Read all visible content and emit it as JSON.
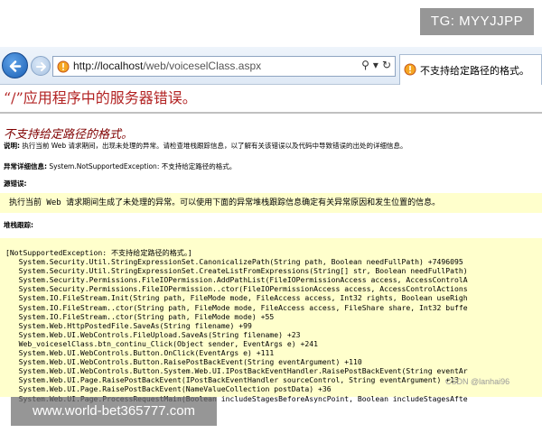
{
  "watermark_top": "TG: MYYJJPP",
  "watermark_bottom": "www.world-bet365777.com",
  "watermark_csdn": "CSDN @lanhai96",
  "browser": {
    "url_host": "http://localhost",
    "url_path": "/web/voiceselClass.aspx",
    "search_icon": "search-icon",
    "refresh_icon": "refresh-icon",
    "tab_title": "不支持给定路径的格式。"
  },
  "page": {
    "app_title": "“/”应用程序中的服务器错误。",
    "error_title": "不支持给定路径的格式。",
    "description_label": "说明:",
    "description_text": "执行当前 Web 请求期间，出现未处理的异常。请检查堆栈跟踪信息，以了解有关该错误以及代码中导致错误的出处的详细信息。",
    "exception_label": "异常详细信息:",
    "exception_text": "System.NotSupportedException: 不支持给定路径的格式。",
    "source_label": "源错误:",
    "source_hint": "执行当前 Web 请求期间生成了未处理的异常。可以使用下面的异常堆栈跟踪信息确定有关异常原因和发生位置的信息。",
    "stack_label": "堆栈跟踪:",
    "stack_trace": [
      "[NotSupportedException: 不支持给定路径的格式。]",
      "   System.Security.Util.StringExpressionSet.CanonicalizePath(String path, Boolean needFullPath) +7496095",
      "   System.Security.Util.StringExpressionSet.CreateListFromExpressions(String[] str, Boolean needFullPath)",
      "   System.Security.Permissions.FileIOPermission.AddPathList(FileIOPermissionAccess access, AccessControlA",
      "   System.Security.Permissions.FileIOPermission..ctor(FileIOPermissionAccess access, AccessControlActions",
      "   System.IO.FileStream.Init(String path, FileMode mode, FileAccess access, Int32 rights, Boolean useRigh",
      "   System.IO.FileStream..ctor(String path, FileMode mode, FileAccess access, FileShare share, Int32 buffe",
      "   System.IO.FileStream..ctor(String path, FileMode mode) +55",
      "   System.Web.HttpPostedFile.SaveAs(String filename) +99",
      "   System.Web.UI.WebControls.FileUpload.SaveAs(String filename) +23",
      "   Web_voiceselClass.btn_continu_Click(Object sender, EventArgs e) +241",
      "   System.Web.UI.WebControls.Button.OnClick(EventArgs e) +111",
      "   System.Web.UI.WebControls.Button.RaisePostBackEvent(String eventArgument) +110",
      "   System.Web.UI.WebControls.Button.System.Web.UI.IPostBackEventHandler.RaisePostBackEvent(String eventAr",
      "   System.Web.UI.Page.RaisePostBackEvent(IPostBackEventHandler sourceControl, String eventArgument) +13",
      "   System.Web.UI.Page.RaisePostBackEvent(NameValueCollection postData) +36",
      "   System.Web.UI.Page.ProcessRequestMain(Boolean includeStagesBeforeAsyncPoint, Boolean includeStagesAfte"
    ]
  },
  "colors": {
    "app_title": "#b22222",
    "error_title": "#800000",
    "code_background": "#ffffcc"
  }
}
